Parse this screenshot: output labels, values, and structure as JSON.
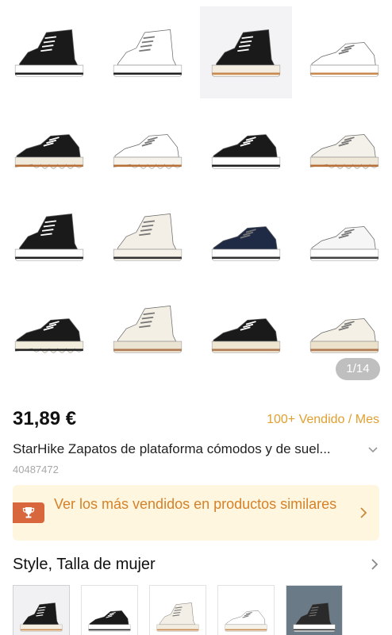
{
  "gallery": {
    "counter": "1/14",
    "images": [
      {
        "icon": "black-high-top-sneaker-icon"
      },
      {
        "icon": "white-high-top-sneaker-icon"
      },
      {
        "icon": "black-high-top-platform-icon"
      },
      {
        "icon": "white-low-top-sneaker-icon"
      },
      {
        "icon": "black-wave-platform-low-icon"
      },
      {
        "icon": "white-wave-platform-high-icon"
      },
      {
        "icon": "black-low-top-platform-icon"
      },
      {
        "icon": "white-wave-platform-low-icon"
      },
      {
        "icon": "black-high-top-chunky-icon"
      },
      {
        "icon": "cream-high-top-chunky-icon"
      },
      {
        "icon": "navy-low-top-chunky-icon"
      },
      {
        "icon": "white-low-top-chunky-icon"
      },
      {
        "icon": "black-wave-platform-high-icon"
      },
      {
        "icon": "cream-high-top-lug-icon"
      },
      {
        "icon": "black-low-top-lug-icon"
      },
      {
        "icon": "cream-low-top-lug-icon"
      }
    ]
  },
  "product": {
    "price": "31,89 €",
    "sold": "100+ Vendido / Mes",
    "title": "StarHike Zapatos de plataforma cómodos y de suel...",
    "sku": "40487472"
  },
  "banner": {
    "text": "Ver los más vendidos en productos similares",
    "icon": "trophy-icon",
    "color": "#d4812a"
  },
  "variants": {
    "title": "Style, Talla de mujer",
    "thumbs": [
      {
        "icon": "black-high-top-platform-icon"
      },
      {
        "icon": "black-low-top-platform-icon"
      },
      {
        "icon": "cream-high-top-platform-icon"
      },
      {
        "icon": "white-low-top-platform-icon"
      },
      {
        "icon": "worn-sneaker-photo-icon"
      }
    ]
  }
}
